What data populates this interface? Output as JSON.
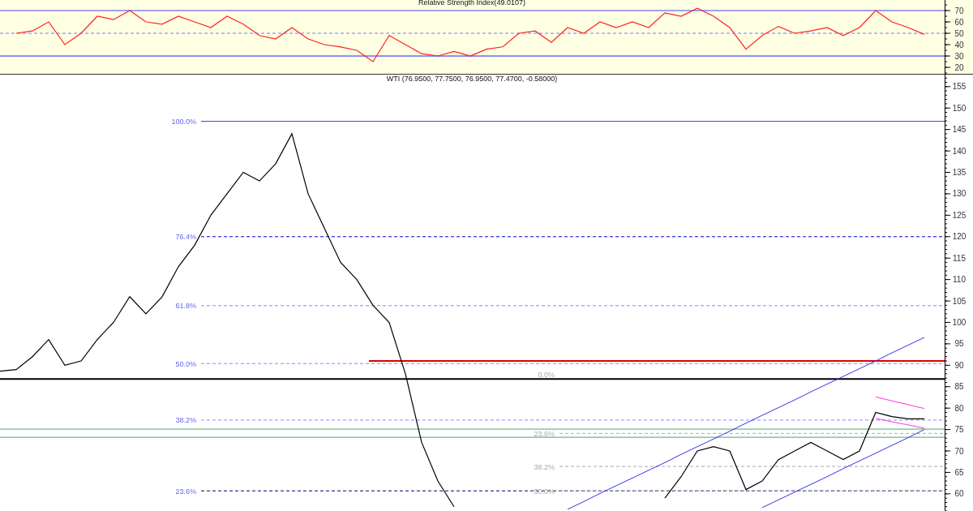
{
  "rsi_panel": {
    "chart_data": {
      "type": "line",
      "title": "Relative Strength Index(49.0107)",
      "categories": [
        null,
        null,
        null,
        null,
        null,
        null,
        null,
        null,
        null,
        null,
        null,
        null,
        null,
        null,
        null,
        null,
        null,
        null,
        null,
        null,
        null,
        null,
        null,
        null,
        null,
        null,
        null,
        null,
        null,
        null,
        null,
        null,
        null,
        null,
        null,
        null,
        null,
        null,
        null,
        null,
        null,
        null,
        null,
        null,
        null,
        null,
        null,
        null,
        null,
        null,
        null,
        null,
        null,
        null,
        null,
        null,
        null,
        null
      ],
      "series": [
        {
          "color": "#ff2020",
          "values": [
            null,
            50,
            52,
            60,
            40,
            50,
            65,
            62,
            70,
            60,
            58,
            65,
            60,
            55,
            65,
            58,
            48,
            45,
            55,
            45,
            40,
            38,
            35,
            25,
            48,
            40,
            32,
            30,
            34,
            30,
            36,
            38,
            50,
            52,
            42,
            55,
            50,
            60,
            55,
            60,
            55,
            68,
            65,
            72,
            65,
            55,
            36,
            48,
            56,
            50,
            52,
            55,
            48,
            55,
            70,
            60,
            55,
            49
          ]
        }
      ],
      "ylim": [
        13.6,
        79.3
      ],
      "yticks": [
        20,
        30,
        40,
        50,
        60,
        70
      ],
      "ref_lines": [
        {
          "axis": "y",
          "value": 70,
          "color": "#4444ff"
        },
        {
          "axis": "y",
          "value": 50,
          "color": "#7777ff"
        },
        {
          "axis": "y",
          "value": 30,
          "color": "#2222ff"
        }
      ]
    }
  },
  "price_panel": {
    "chart_data": {
      "type": "line",
      "title": "WTI (76.9500, 77.7500, 76.9500, 77.4700, -0.58000)",
      "categories": [
        null,
        null,
        null,
        null,
        null,
        null,
        null,
        null,
        null,
        null,
        null,
        null,
        null,
        null,
        null,
        null,
        null,
        null,
        null,
        null,
        null,
        null,
        null,
        null,
        null,
        null,
        null,
        null,
        null,
        null,
        null,
        null,
        null,
        null,
        null,
        null,
        null,
        null,
        null,
        null,
        null,
        null,
        null,
        null,
        null,
        null,
        null,
        null,
        null,
        null,
        null,
        null,
        null,
        null,
        null,
        null,
        null,
        null
      ],
      "series": [
        {
          "color": "#000000",
          "values": [
            88.6,
            89,
            92,
            96,
            90,
            91,
            96,
            100,
            106,
            102,
            106,
            113,
            118,
            125,
            130,
            135,
            133,
            137,
            144,
            130,
            122,
            114,
            110,
            104,
            100,
            88,
            72,
            63,
            57,
            null,
            null,
            null,
            null,
            null,
            null,
            null,
            null,
            null,
            null,
            null,
            null,
            59,
            64,
            70,
            71,
            70,
            61,
            63,
            68,
            70,
            72,
            70,
            68,
            70,
            79,
            78,
            77.5,
            77.5
          ]
        },
        {
          "color": "#3333ee",
          "values": [
            null,
            null,
            null,
            null,
            null,
            null,
            null,
            null,
            null,
            null,
            null,
            null,
            null,
            null,
            null,
            null,
            null,
            null,
            null,
            null,
            null,
            null,
            null,
            null,
            null,
            null,
            null,
            null,
            null,
            null,
            null,
            null,
            null,
            null,
            null,
            56.4,
            58.2,
            60.1,
            61.9,
            63.7,
            65.5,
            67.3,
            69.2,
            71.0,
            72.8,
            74.6,
            76.5,
            78.3,
            80.1,
            81.9,
            83.8,
            85.6,
            87.4,
            89.2,
            91.0,
            92.9,
            94.7,
            96.5
          ]
        },
        {
          "color": "#3333ee",
          "values": [
            null,
            null,
            null,
            null,
            null,
            null,
            null,
            null,
            null,
            null,
            null,
            null,
            null,
            null,
            null,
            null,
            null,
            null,
            null,
            null,
            null,
            null,
            null,
            null,
            null,
            null,
            null,
            null,
            null,
            null,
            null,
            null,
            null,
            null,
            null,
            null,
            null,
            null,
            null,
            null,
            null,
            null,
            null,
            null,
            null,
            null,
            null,
            56.8,
            58.6,
            60.4,
            62.2,
            64.0,
            65.9,
            67.7,
            69.5,
            71.3,
            73.1,
            75.0
          ]
        },
        {
          "color": "#ff33dd",
          "values": [
            null,
            null,
            null,
            null,
            null,
            null,
            null,
            null,
            null,
            null,
            null,
            null,
            null,
            null,
            null,
            null,
            null,
            null,
            null,
            null,
            null,
            null,
            null,
            null,
            null,
            null,
            null,
            null,
            null,
            null,
            null,
            null,
            null,
            null,
            null,
            null,
            null,
            null,
            null,
            null,
            null,
            null,
            null,
            null,
            null,
            null,
            null,
            null,
            null,
            null,
            null,
            null,
            null,
            null,
            82.6,
            81.7,
            80.8,
            79.9
          ]
        },
        {
          "color": "#ff33dd",
          "values": [
            null,
            null,
            null,
            null,
            null,
            null,
            null,
            null,
            null,
            null,
            null,
            null,
            null,
            null,
            null,
            null,
            null,
            null,
            null,
            null,
            null,
            null,
            null,
            null,
            null,
            null,
            null,
            null,
            null,
            null,
            null,
            null,
            null,
            null,
            null,
            null,
            null,
            null,
            null,
            null,
            null,
            null,
            null,
            null,
            null,
            null,
            null,
            null,
            null,
            null,
            null,
            null,
            null,
            null,
            77.6,
            76.8,
            76.1,
            75.3
          ]
        }
      ],
      "ylim": [
        56,
        157.8
      ],
      "yticks": [
        60,
        65,
        70,
        75,
        80,
        85,
        90,
        95,
        100,
        105,
        110,
        115,
        120,
        125,
        130,
        135,
        140,
        145,
        150,
        155
      ],
      "ref_lines": [
        {
          "axis": "y",
          "value": 146.9,
          "color": "#3333ff"
        },
        {
          "axis": "y",
          "value": 120,
          "color": "#0000cc"
        },
        {
          "axis": "y",
          "value": 103.9,
          "color": "#8888ff"
        },
        {
          "axis": "y",
          "value": 90.4,
          "color": "#8888ff"
        },
        {
          "axis": "y",
          "value": 77.2,
          "color": "#8888ff"
        },
        {
          "axis": "y",
          "value": 60.7,
          "color": "#000066"
        },
        {
          "axis": "y",
          "value": 91,
          "color": "#dd0000"
        },
        {
          "axis": "y",
          "value": 86.8,
          "color": "#000000"
        },
        {
          "axis": "y",
          "value": 75.1,
          "color": "#44aa66"
        },
        {
          "axis": "y",
          "value": 73.2,
          "color": "#44aa66"
        },
        {
          "axis": "y",
          "value": 74.1,
          "color": "#aaaaaa"
        },
        {
          "axis": "y",
          "value": 66.4,
          "color": "#aaaaaa"
        },
        {
          "axis": "y",
          "value": 60.7,
          "color": "#aaaaaa"
        }
      ]
    },
    "fib_labels": [
      {
        "label": "100.0%"
      },
      {
        "label": "76.4%"
      },
      {
        "label": "61.8%"
      },
      {
        "label": "50.0%"
      },
      {
        "label": "38.2%"
      },
      {
        "label": "23.6%"
      },
      {
        "label": "0.0%"
      },
      {
        "label": "23.6%"
      },
      {
        "label": "38.2%"
      },
      {
        "label": "50.0%"
      }
    ]
  }
}
